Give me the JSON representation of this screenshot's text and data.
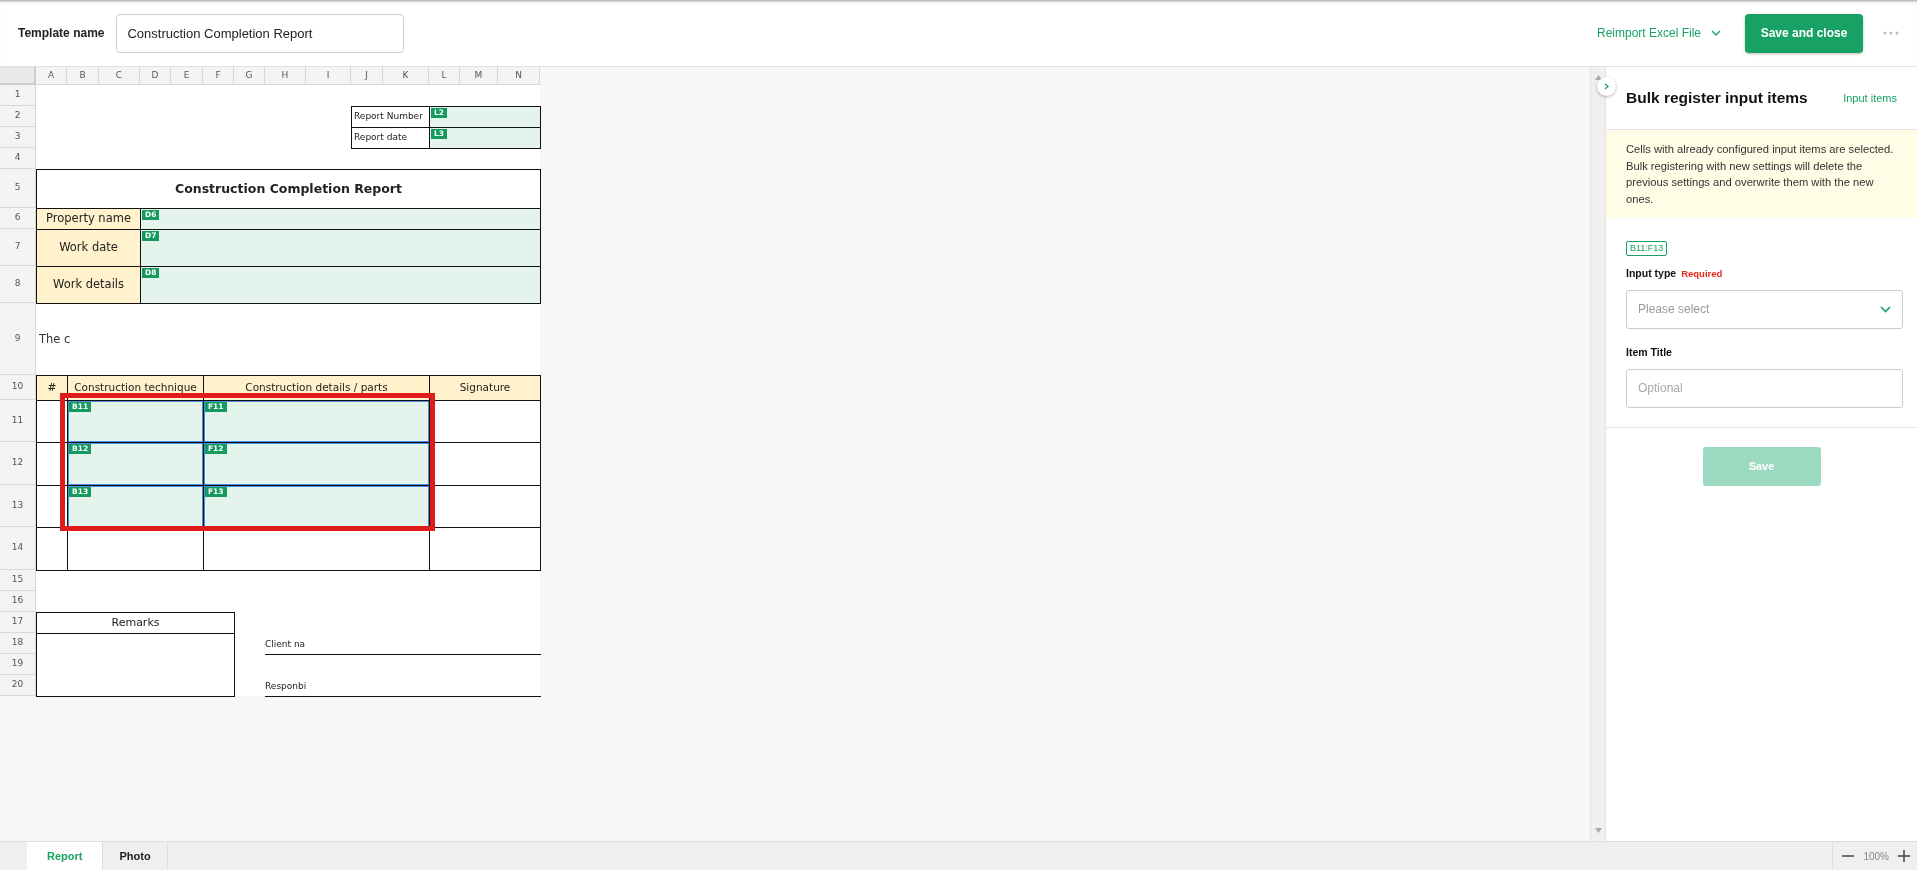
{
  "header": {
    "label": "Template name",
    "template_name": "Construction Completion Report",
    "reimport": "Reimport Excel File",
    "save_close": "Save and close"
  },
  "sheet": {
    "columns": [
      "A",
      "B",
      "C",
      "D",
      "E",
      "F",
      "G",
      "H",
      "I",
      "J",
      "K",
      "L",
      "M",
      "N"
    ],
    "rows": [
      "1",
      "2",
      "3",
      "4",
      "5",
      "6",
      "7",
      "8",
      "9",
      "10",
      "11",
      "12",
      "13",
      "14",
      "15",
      "16",
      "17",
      "18",
      "19",
      "20"
    ],
    "annotation_frame": true,
    "cells": [
      {
        "kind": "label",
        "text": "Report Number"
      },
      {
        "kind": "input",
        "badge": "L2",
        "selected": false
      },
      {
        "kind": "label",
        "text": "Report date"
      },
      {
        "kind": "input",
        "badge": "L3",
        "selected": false
      },
      {
        "kind": "title",
        "text": "Construction Completion Report"
      },
      {
        "kind": "field",
        "text": "Property name"
      },
      {
        "kind": "input",
        "badge": "D6",
        "selected": false
      },
      {
        "kind": "field",
        "text": "Work date"
      },
      {
        "kind": "input",
        "badge": "D7",
        "selected": false
      },
      {
        "kind": "field",
        "text": "Work details"
      },
      {
        "kind": "input",
        "badge": "D8",
        "selected": false
      },
      {
        "kind": "note",
        "text": "The c"
      },
      {
        "kind": "header",
        "text": "#"
      },
      {
        "kind": "header",
        "text": "Construction technique"
      },
      {
        "kind": "header",
        "text": "Construction details / parts"
      },
      {
        "kind": "header",
        "text": "Signature"
      },
      {
        "kind": "input",
        "badge": "B11",
        "selected": true
      },
      {
        "kind": "input",
        "badge": "F11",
        "selected": true
      },
      {
        "kind": "input",
        "badge": "B12",
        "selected": true
      },
      {
        "kind": "input",
        "badge": "F12",
        "selected": true
      },
      {
        "kind": "input",
        "badge": "B13",
        "selected": true
      },
      {
        "kind": "input",
        "badge": "F13",
        "selected": true
      },
      {
        "kind": "caption",
        "text": "Remarks"
      },
      {
        "kind": "line",
        "text": "Client na"
      },
      {
        "kind": "line",
        "text": "Responbi"
      }
    ]
  },
  "panel": {
    "title": "Bulk register input items",
    "link": "Input items",
    "notice": "Cells with already configured input items are selected. Bulk registering with new settings will delete the previous settings and overwrite them with the new ones.",
    "range": "B11:F13",
    "input_type_label": "Input type",
    "required": "Required",
    "select_placeholder": "Please select",
    "item_title_label": "Item Title",
    "item_title_placeholder": "Optional",
    "save": "Save",
    "save_disabled": true
  },
  "tabs": [
    {
      "label": "Report",
      "selected": true
    },
    {
      "label": "Photo",
      "selected": false
    }
  ],
  "zoom": {
    "text": "100%"
  }
}
